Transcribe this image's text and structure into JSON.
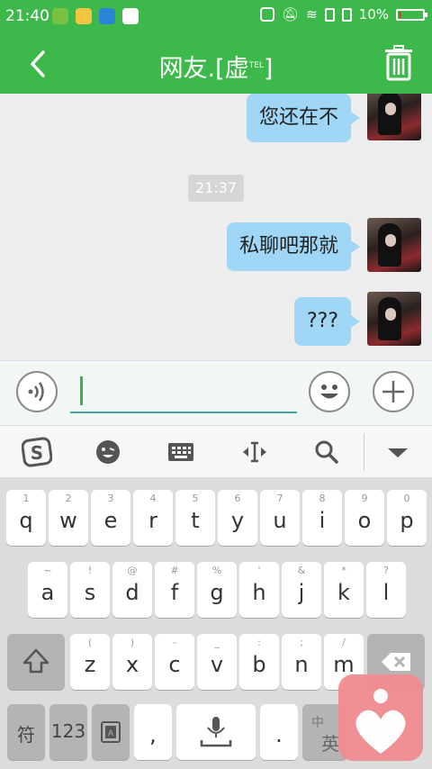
{
  "status_bar": {
    "time": "21:40",
    "battery_percent": "10%"
  },
  "header": {
    "title": "网友.[虚",
    "title_superscript": "TEL",
    "title_close": "]"
  },
  "messages": [
    {
      "text": "您还在不"
    },
    {
      "text": "私聊吧那就"
    },
    {
      "text": "???"
    }
  ],
  "timestamp": "21:37",
  "input": {
    "value": ""
  },
  "keyboard": {
    "row1": [
      {
        "num": "1",
        "letter": "q"
      },
      {
        "num": "2",
        "letter": "w"
      },
      {
        "num": "3",
        "letter": "e"
      },
      {
        "num": "4",
        "letter": "r"
      },
      {
        "num": "5",
        "letter": "t"
      },
      {
        "num": "6",
        "letter": "y"
      },
      {
        "num": "7",
        "letter": "u"
      },
      {
        "num": "8",
        "letter": "i"
      },
      {
        "num": "9",
        "letter": "o"
      },
      {
        "num": "0",
        "letter": "p"
      }
    ],
    "row2": [
      {
        "sym": "~",
        "letter": "a"
      },
      {
        "sym": "!",
        "letter": "s"
      },
      {
        "sym": "@",
        "letter": "d"
      },
      {
        "sym": "#",
        "letter": "f"
      },
      {
        "sym": "%",
        "letter": "g"
      },
      {
        "sym": "'",
        "letter": "h"
      },
      {
        "sym": "&",
        "letter": "j"
      },
      {
        "sym": "*",
        "letter": "k"
      },
      {
        "sym": "?",
        "letter": "l"
      }
    ],
    "row3": [
      {
        "sym": "(",
        "letter": "z"
      },
      {
        "sym": ")",
        "letter": "x"
      },
      {
        "sym": "-",
        "letter": "c"
      },
      {
        "sym": "_",
        "letter": "v"
      },
      {
        "sym": ":",
        "letter": "b"
      },
      {
        "sym": ";",
        "letter": "n"
      },
      {
        "sym": "/",
        "letter": "m"
      }
    ],
    "symbol_key": "符",
    "number_key": "123",
    "comma_key": ",",
    "period_key": ".",
    "lang_key_top": "中",
    "lang_key_bottom": "英"
  },
  "colors": {
    "accent_green": "#3cb94a",
    "bubble_blue": "#9fd6f5",
    "input_underline": "#3aa7a8"
  }
}
